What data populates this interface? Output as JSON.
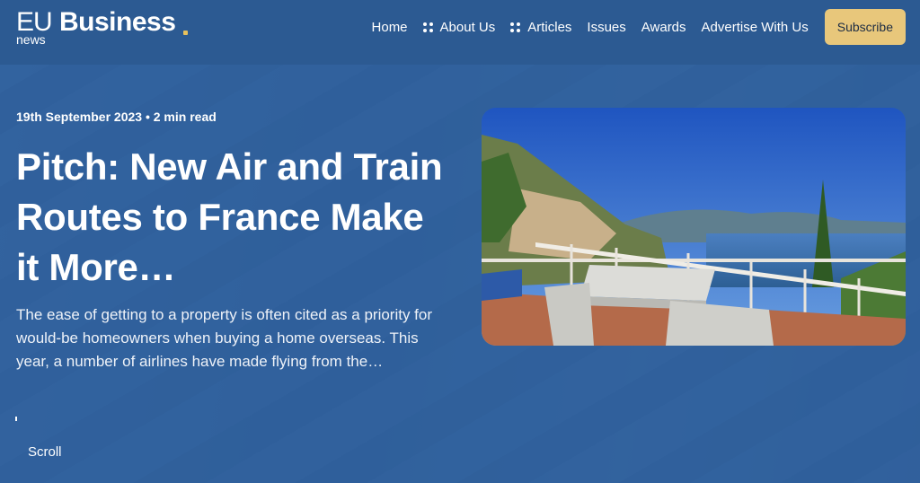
{
  "brand": {
    "eu": "EU",
    "business": "Business",
    "news": "news",
    "accent": "#e8c15d"
  },
  "nav": {
    "items": [
      {
        "label": "Home",
        "dotted": false
      },
      {
        "label": "About Us",
        "dotted": true
      },
      {
        "label": "Articles",
        "dotted": true
      },
      {
        "label": "Issues",
        "dotted": false
      },
      {
        "label": "Awards",
        "dotted": false
      },
      {
        "label": "Advertise With Us",
        "dotted": false
      }
    ],
    "subscribe_label": "Subscribe",
    "subscribe_color": "#e8c77b"
  },
  "article": {
    "meta": "19th September 2023 • 2 min read",
    "title": "Pitch: New Air and Train Routes to France Make it More…",
    "excerpt": "The ease of getting to a property is often cited as a priority for would-be homeowners when buying a home overseas. This year, a number of airlines have made flying from the…"
  },
  "scroll_label": "Scroll",
  "colors": {
    "background": "#31609c",
    "header": "#2c5a92"
  }
}
